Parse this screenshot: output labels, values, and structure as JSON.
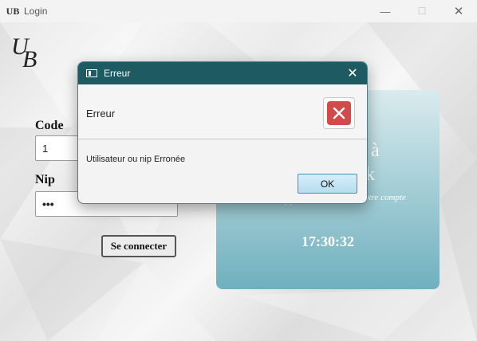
{
  "window": {
    "title": "Login",
    "app_icon_text": "UB",
    "controls": {
      "minimize": "—",
      "maximize": "☐",
      "close": "✕"
    }
  },
  "logo": {
    "u": "U",
    "b": "B"
  },
  "form": {
    "code_label": "Code",
    "code_value": "1",
    "nip_label": "Nip",
    "nip_value": "•••",
    "connect_label": "Se connecter"
  },
  "panel": {
    "partial_line1": "à",
    "partial_line2": "k",
    "partial_line3": "( )",
    "subtitle_partial": "otre compte",
    "clock": "17:30:32"
  },
  "dialog": {
    "title": "Erreur",
    "header": "Erreur",
    "message": "Utilisateur ou nip Erronée",
    "ok_label": "OK",
    "close_glyph": "✕",
    "icon": "error-x-icon"
  },
  "colors": {
    "dialog_title_bg": "#1e5a62",
    "error_red": "#d34a4a",
    "panel_teal": "#6fb0be",
    "ok_button": "#b6ddf0"
  }
}
